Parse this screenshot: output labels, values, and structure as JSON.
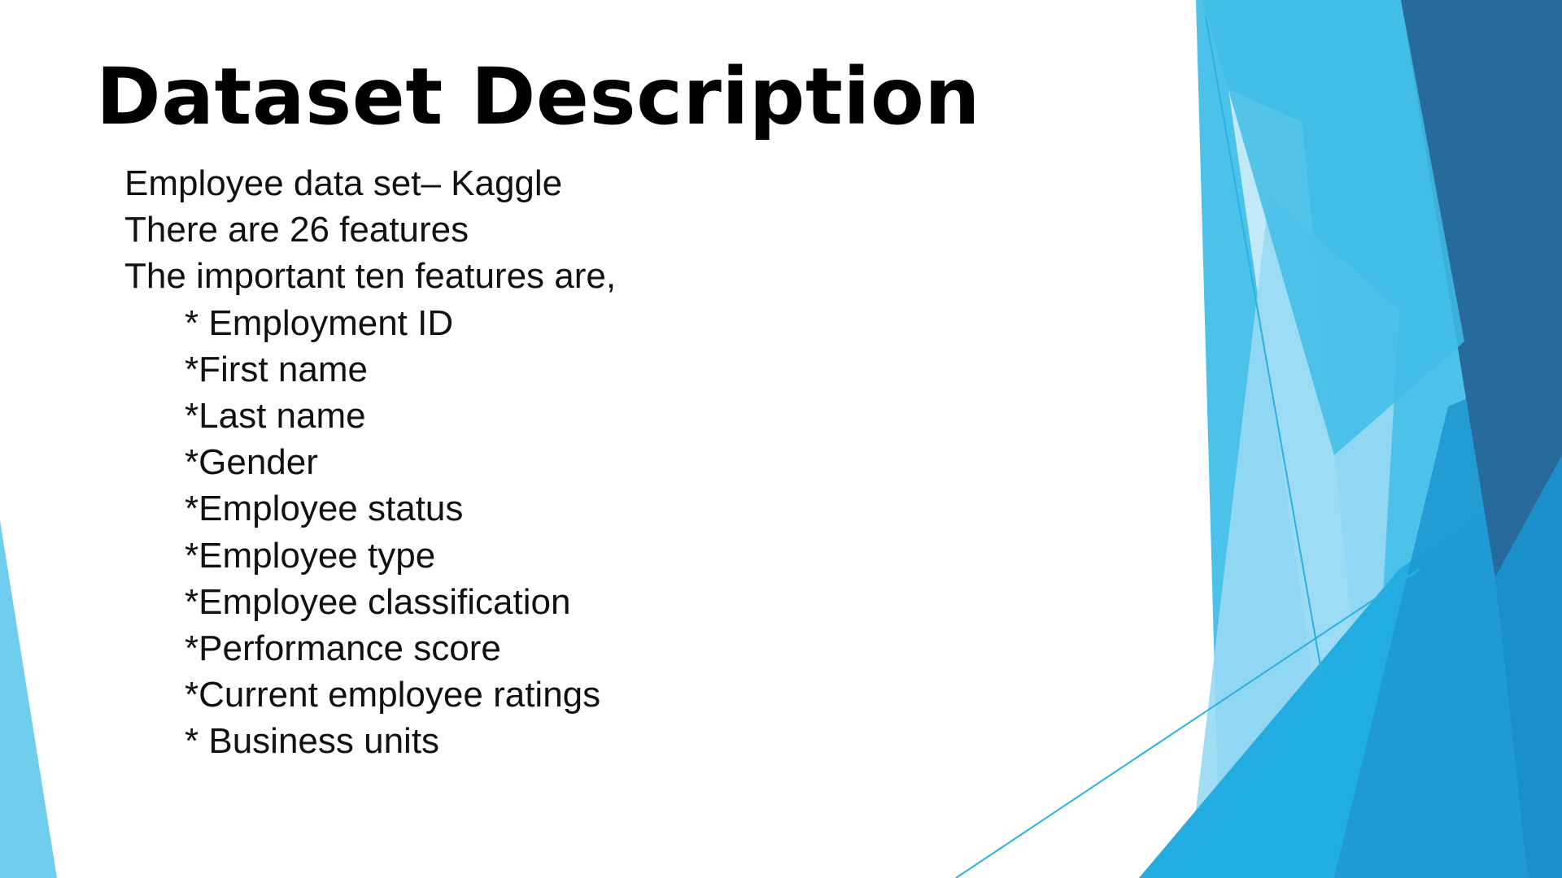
{
  "slide": {
    "title": "Dataset Description",
    "intro_lines": [
      "Employee data set– Kaggle",
      "There are 26 features",
      "The important ten features are,"
    ],
    "feature_items": [
      "* Employment ID",
      "*First name",
      "*Last name",
      "*Gender",
      "*Employee status",
      "*Employee type",
      "*Employee classification",
      "*Performance score",
      "*Current employee ratings",
      "* Business units"
    ]
  },
  "theme": {
    "background": "#ffffff",
    "accent_light": "#6fcdee",
    "accent_mid": "#29b4e6",
    "accent_dark": "#256a9c"
  }
}
